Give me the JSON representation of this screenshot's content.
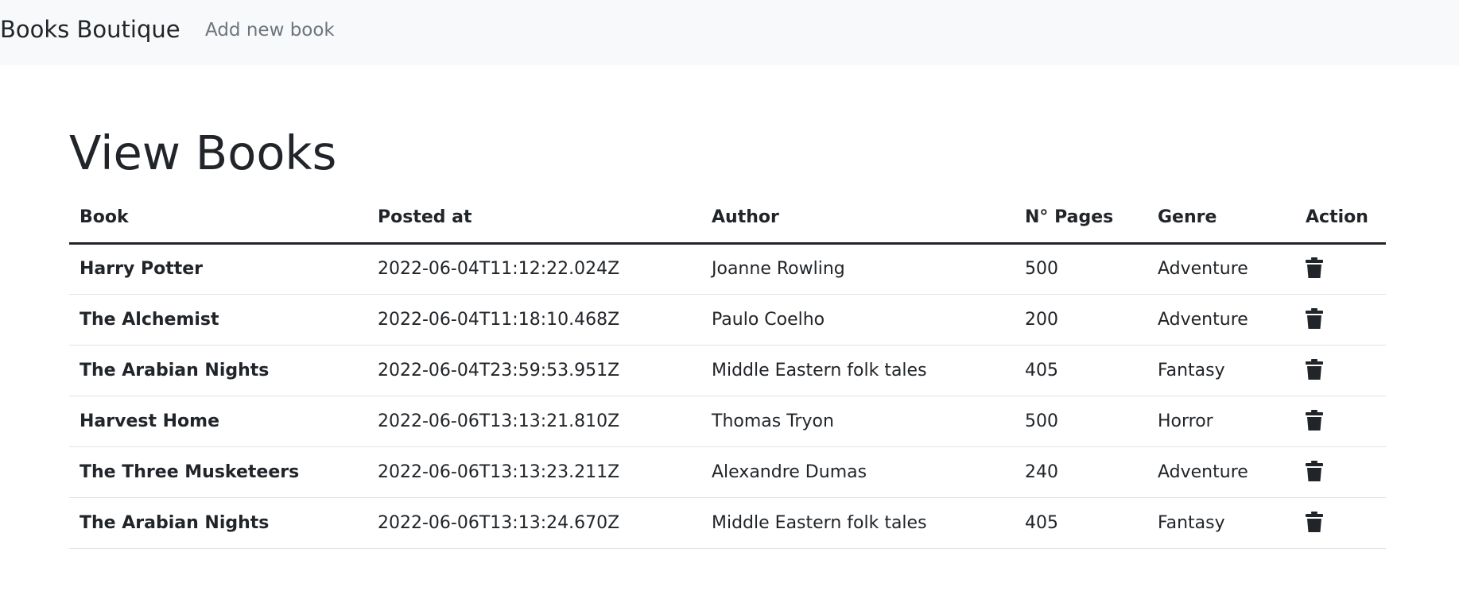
{
  "navbar": {
    "brand": "Books Boutique",
    "add_link": "Add new book"
  },
  "page": {
    "title": "View Books"
  },
  "table": {
    "headers": {
      "book": "Book",
      "posted_at": "Posted at",
      "author": "Author",
      "pages": "N° Pages",
      "genre": "Genre",
      "action": "Action"
    },
    "rows": [
      {
        "book": "Harry Potter",
        "posted_at": "2022-06-04T11:12:22.024Z",
        "author": "Joanne Rowling",
        "pages": "500",
        "genre": "Adventure",
        "action_icon": "trash-icon"
      },
      {
        "book": "The Alchemist",
        "posted_at": "2022-06-04T11:18:10.468Z",
        "author": "Paulo Coelho",
        "pages": "200",
        "genre": "Adventure",
        "action_icon": "trash-icon"
      },
      {
        "book": "The Arabian Nights",
        "posted_at": "2022-06-04T23:59:53.951Z",
        "author": "Middle Eastern folk tales",
        "pages": "405",
        "genre": "Fantasy",
        "action_icon": "trash-icon"
      },
      {
        "book": "Harvest Home",
        "posted_at": "2022-06-06T13:13:21.810Z",
        "author": "Thomas Tryon",
        "pages": "500",
        "genre": "Horror",
        "action_icon": "trash-icon"
      },
      {
        "book": "The Three Musketeers",
        "posted_at": "2022-06-06T13:13:23.211Z",
        "author": "Alexandre Dumas",
        "pages": "240",
        "genre": "Adventure",
        "action_icon": "trash-icon"
      },
      {
        "book": "The Arabian Nights",
        "posted_at": "2022-06-06T13:13:24.670Z",
        "author": "Middle Eastern folk tales",
        "pages": "405",
        "genre": "Fantasy",
        "action_icon": "trash-icon"
      }
    ]
  },
  "colors": {
    "navbar_bg": "#f8f9fa",
    "text": "#212529",
    "muted_link": "#6c757d",
    "row_border": "#dee2e6"
  }
}
